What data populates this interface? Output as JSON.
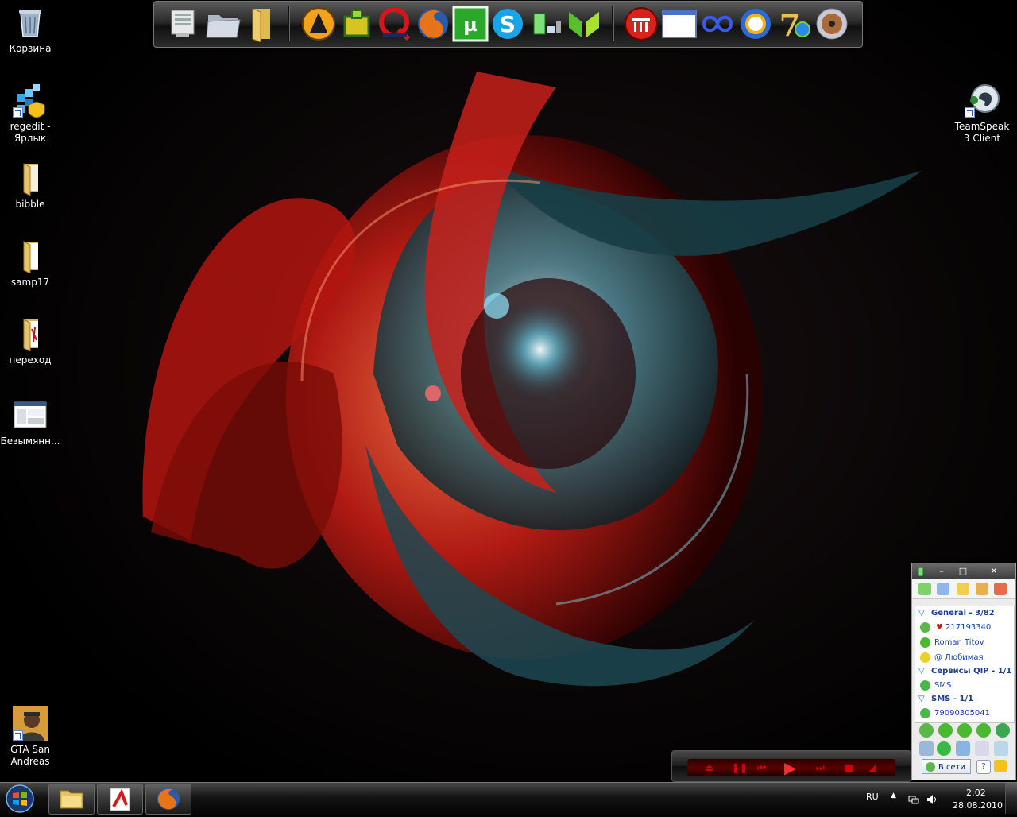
{
  "desktop": {
    "icons": [
      {
        "label": "Корзина",
        "icon": "recycle-bin-icon"
      },
      {
        "label": "regedit - Ярлык",
        "icon": "registry-editor-icon"
      },
      {
        "label": "bibble",
        "icon": "folder-icon"
      },
      {
        "label": "samp17",
        "icon": "folder-icon"
      },
      {
        "label": "переход",
        "icon": "folder-icon"
      },
      {
        "label": "Безымянн...",
        "icon": "image-file-icon"
      },
      {
        "label": "GTA San Andreas",
        "icon": "gta-game-icon"
      },
      {
        "label": "TeamSpeak 3 Client",
        "icon": "teamspeak-icon"
      }
    ]
  },
  "dock": {
    "items": [
      "computer-icon",
      "documents-folder-icon",
      "folder-icon",
      "aimp-icon",
      "game-icon",
      "opera-q-icon",
      "firefox-icon",
      "utorrent-icon",
      "skype-icon",
      "qip-icon",
      "flash-icon",
      "red-circle-app-icon",
      "window-icon",
      "infinity-icon",
      "gear-sun-icon",
      "windows7-logo-icon",
      "disc-icon"
    ]
  },
  "qip": {
    "groups": [
      {
        "label": "General - 3/82",
        "contacts": [
          "217193340",
          "Roman Titov",
          "@ Любимая"
        ]
      },
      {
        "label": "Сервисы QIP - 1/1",
        "contacts": [
          "SMS"
        ]
      },
      {
        "label": "SMS - 1/1",
        "contacts": [
          "79090305041"
        ]
      }
    ],
    "status_label": "В сети"
  },
  "taskbar": {
    "language": "RU",
    "time": "2:02",
    "date": "28.08.2010",
    "apps": [
      "explorer-icon",
      "acrobat-icon",
      "firefox-icon"
    ]
  },
  "colors": {
    "accent_red": "#c81e1e",
    "accent_teal": "#4ea7b5"
  }
}
